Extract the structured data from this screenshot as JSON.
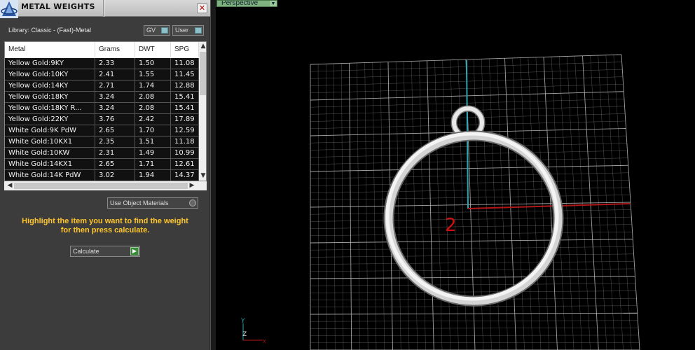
{
  "window": {
    "title": "METAL WEIGHTS",
    "close_glyph": "✕"
  },
  "library": {
    "label": "Library: Classic - (Fast)-Metal"
  },
  "buttons": {
    "gv_label": "GV",
    "user_label": "User",
    "use_object_materials": "Use Object Materials",
    "calculate": "Calculate",
    "go_glyph": "▶"
  },
  "table": {
    "columns": [
      "Metal",
      "Grams",
      "DWT",
      "SPG"
    ],
    "rows": [
      [
        "Yellow Gold:9KY",
        "2.33",
        "1.50",
        "11.08"
      ],
      [
        "Yellow Gold:10KY",
        "2.41",
        "1.55",
        "11.45"
      ],
      [
        "Yellow Gold:14KY",
        "2.71",
        "1.74",
        "12.88"
      ],
      [
        "Yellow Gold:18KY",
        "3.24",
        "2.08",
        "15.41"
      ],
      [
        "Yellow Gold:18KY R...",
        "3.24",
        "2.08",
        "15.41"
      ],
      [
        "Yellow Gold:22KY",
        "3.76",
        "2.42",
        "17.89"
      ],
      [
        "White Gold:9K PdW",
        "2.65",
        "1.70",
        "12.59"
      ],
      [
        "White Gold:10KX1",
        "2.35",
        "1.51",
        "11.18"
      ],
      [
        "White Gold:10KW",
        "2.31",
        "1.49",
        "10.99"
      ],
      [
        "White Gold:14KX1",
        "2.65",
        "1.71",
        "12.61"
      ],
      [
        "White Gold:14K PdW",
        "3.02",
        "1.94",
        "14.37"
      ]
    ],
    "scroll_up": "▲",
    "scroll_down": "▼",
    "scroll_left": "◀",
    "scroll_right": "▶"
  },
  "hint": {
    "line1": "Highlight the item you want to find the weight",
    "line2": "for then press calculate."
  },
  "viewport": {
    "label": "Perspective",
    "drop_glyph": "▼",
    "marker_number": "2",
    "axis_y": "Y",
    "axis_z": "Z",
    "axis_x": "X"
  },
  "colors": {
    "highlight": "#ffc62a",
    "grid": "#bdbdbd",
    "axis_x": "#b01818",
    "axis_y": "#2aa6b0",
    "marker": "#d01010"
  }
}
